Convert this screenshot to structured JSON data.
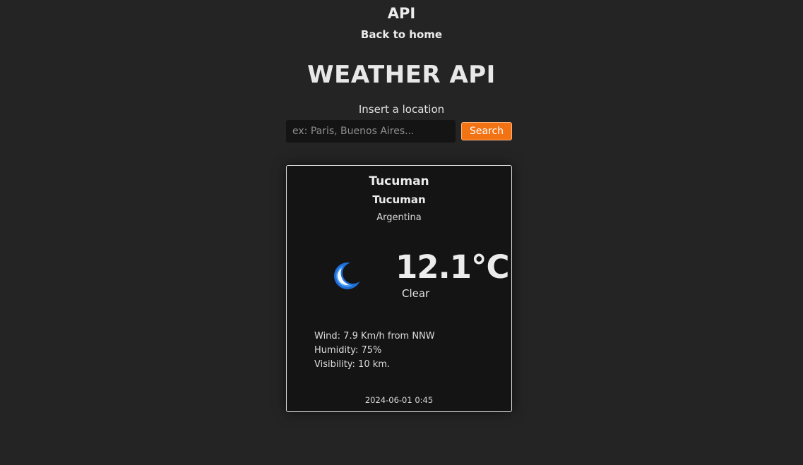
{
  "header": {
    "site_title": "API",
    "back_link": "Back to home"
  },
  "main": {
    "title": "WEATHER API",
    "search": {
      "label": "Insert a location",
      "placeholder": "ex: Paris, Buenos Aires...",
      "value": "",
      "button_label": "Search"
    },
    "weather": {
      "city": "Tucuman",
      "region": "Tucuman",
      "country": "Argentina",
      "icon": "crescent-moon-icon",
      "temperature": "12.1°C",
      "condition": "Clear",
      "wind": "Wind: 7.9 Km/h from NNW",
      "humidity": "Humidity: 75%",
      "visibility": "Visibility: 10 km.",
      "timestamp": "2024-06-01 0:45"
    }
  },
  "colors": {
    "background": "#242424",
    "card_background": "#141414",
    "accent": "#f27313",
    "moon_blue": "#1e6fd9"
  }
}
